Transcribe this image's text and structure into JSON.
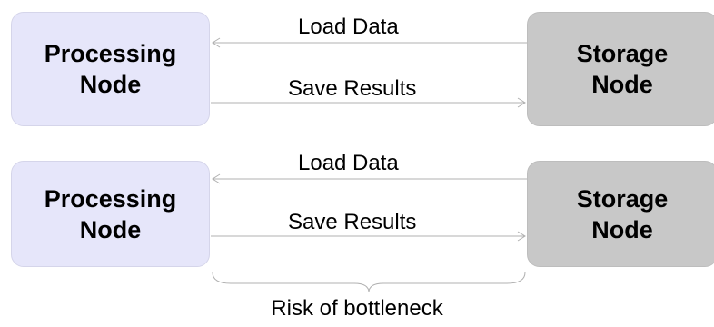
{
  "pairs": [
    {
      "processing_node": {
        "line1": "Processing",
        "line2": "Node"
      },
      "storage_node": {
        "line1": "Storage",
        "line2": "Node"
      },
      "load_label": "Load Data",
      "save_label": "Save Results"
    },
    {
      "processing_node": {
        "line1": "Processing",
        "line2": "Node"
      },
      "storage_node": {
        "line1": "Storage",
        "line2": "Node"
      },
      "load_label": "Load Data",
      "save_label": "Save Results"
    }
  ],
  "bottleneck_caption": "Risk of bottleneck",
  "colors": {
    "processing_fill": "#e6e6fa",
    "storage_fill": "#c8c8c8",
    "connector": "#b0b0b0"
  }
}
